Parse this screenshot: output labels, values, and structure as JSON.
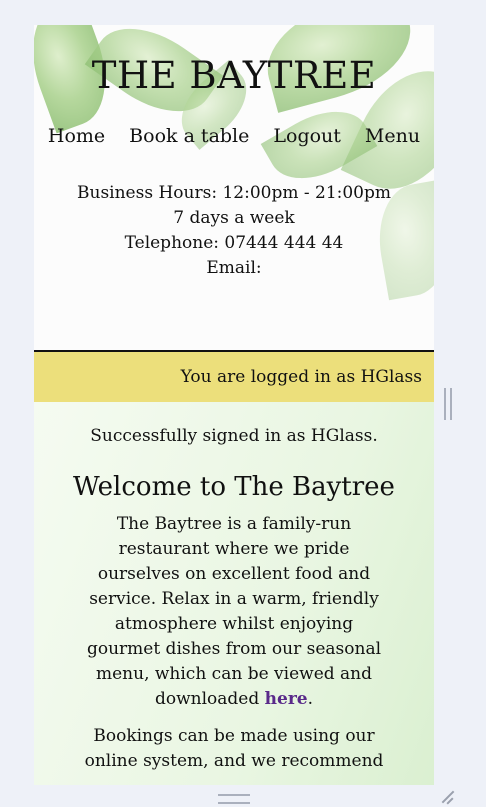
{
  "header": {
    "brand": "THE BAYTREE",
    "nav": {
      "home": "Home",
      "book": "Book a table",
      "logout": "Logout",
      "menu": "Menu"
    },
    "info": {
      "hours": "Business Hours: 12:00pm - 21:00pm",
      "days": "7 days a week",
      "phone": "Telephone: 07444 444 44",
      "email": "Email:"
    }
  },
  "login_bar": {
    "text": "You are logged in as HGlass"
  },
  "main": {
    "signed_in": "Successfully signed in as HGlass.",
    "welcome": "Welcome to The Baytree",
    "para1_text": "The Baytree is a family-run restaurant where we pride ourselves on excellent food and service. Relax in a warm, friendly atmosphere whilst enjoying gourmet dishes from our seasonal menu, which can be viewed and downloaded",
    "para1_link": "here",
    "para1_end": ".",
    "para2": "Bookings can be made using our online system, and we recommend"
  },
  "colors": {
    "login_bar": "#ecdf7b",
    "link": "#5a2a8a"
  }
}
